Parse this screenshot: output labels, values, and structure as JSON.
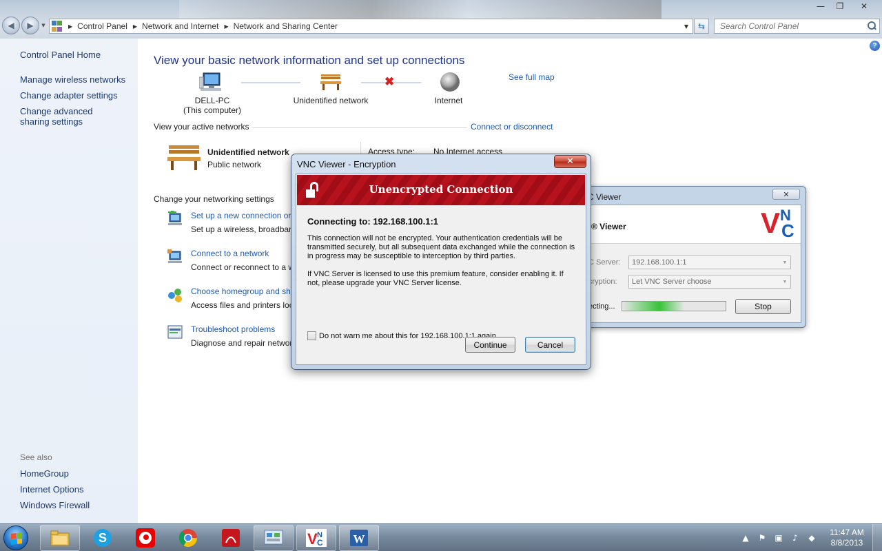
{
  "window": {
    "minimize_glyph": "—",
    "restore_glyph": "❐",
    "close_glyph": "✕"
  },
  "address": {
    "crumbs": [
      "Control Panel",
      "Network and Internet",
      "Network and Sharing Center"
    ],
    "search_placeholder": "Search Control Panel"
  },
  "sidebar": {
    "home": "Control Panel Home",
    "items": [
      "Manage wireless networks",
      "Change adapter settings",
      "Change advanced sharing settings"
    ],
    "see_also_label": "See also",
    "see_also": [
      "HomeGroup",
      "Internet Options",
      "Windows Firewall"
    ]
  },
  "main": {
    "title": "View your basic network information and set up connections",
    "see_full_map": "See full map",
    "map": {
      "computer_name": "DELL-PC",
      "computer_sub": "(This computer)",
      "network": "Unidentified network",
      "internet": "Internet"
    },
    "active_networks_heading": "View your active networks",
    "connect_or_disconnect": "Connect or disconnect",
    "active_network": {
      "name": "Unidentified network",
      "type": "Public network",
      "access_label": "Access type:",
      "access_value": "No Internet access"
    },
    "change_settings_heading": "Change your networking settings",
    "settings": [
      {
        "link": "Set up a new connection or",
        "desc": "Set up a wireless, broadband"
      },
      {
        "link": "Connect to a network",
        "desc": "Connect or reconnect to a w"
      },
      {
        "link": "Choose homegroup and sh",
        "desc": "Access files and printers loc"
      },
      {
        "link": "Troubleshoot problems",
        "desc": "Diagnose and repair network"
      }
    ]
  },
  "vnc_window": {
    "title": "C Viewer",
    "header": "® Viewer",
    "logo_v": "V",
    "logo_n": "N",
    "logo_c": "C",
    "server_label": "C Server:",
    "server_value": "192.168.100.1:1",
    "encryption_label": "cryption:",
    "encryption_value": "Let VNC Server choose",
    "status_label": "ecting...",
    "progress_fraction": 0.6,
    "stop_label": "Stop"
  },
  "dialog": {
    "title": "VNC Viewer - Encryption",
    "banner": "Unencrypted Connection",
    "connecting": "Connecting to: 192.168.100.1:1",
    "para1": "This connection will not be encrypted. Your authentication credentials will be transmitted securely, but all subsequent data exchanged while the connection is in progress may be susceptible to interception by third parties.",
    "para2": "If VNC Server is licensed to use this premium feature, consider enabling it. If not, please upgrade your VNC Server license.",
    "checkbox_label": "Do not warn me about this for 192.168.100.1:1 again",
    "continue_label": "Continue",
    "cancel_label": "Cancel"
  },
  "taskbar": {
    "time": "11:47 AM",
    "date": "8/8/2013",
    "apps": [
      "explorer-icon",
      "skype-icon",
      "vodafone-icon",
      "chrome-icon",
      "acrobat-icon",
      "control-panel-icon",
      "vnc-icon",
      "word-icon"
    ]
  }
}
